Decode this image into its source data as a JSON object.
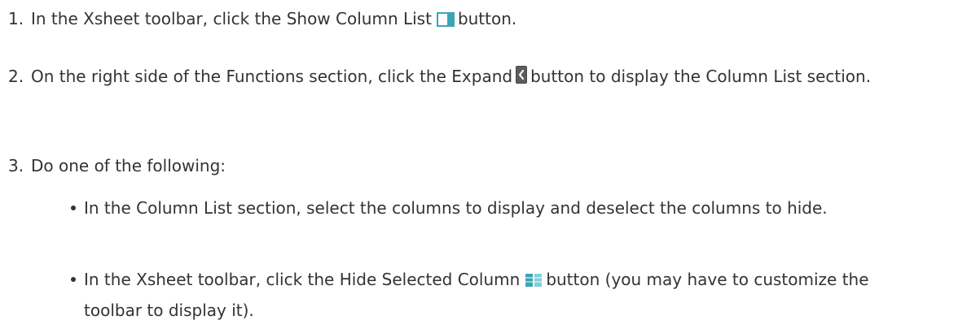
{
  "steps": [
    {
      "number": "1.",
      "before": "In the Xsheet toolbar, click the Show Column List",
      "after": "button.",
      "icon": "show-column-list-icon"
    },
    {
      "number": "2.",
      "before": "On the right side of the Functions section, click the Expand",
      "after": "button to display the Column List section.",
      "icon": "expand-icon"
    },
    {
      "number": "3.",
      "text": "Do one of the following:",
      "bullets": [
        {
          "text": "In the Column List section, select the columns to display and deselect the columns to hide."
        },
        {
          "before": "In the Xsheet toolbar, click the Hide Selected Column",
          "after": "button (you may have to customize the toolbar to display it).",
          "icon": "hide-selected-column-icon"
        }
      ]
    }
  ],
  "colors": {
    "text": "#333333",
    "icon_accent": "#3aa6b5"
  }
}
